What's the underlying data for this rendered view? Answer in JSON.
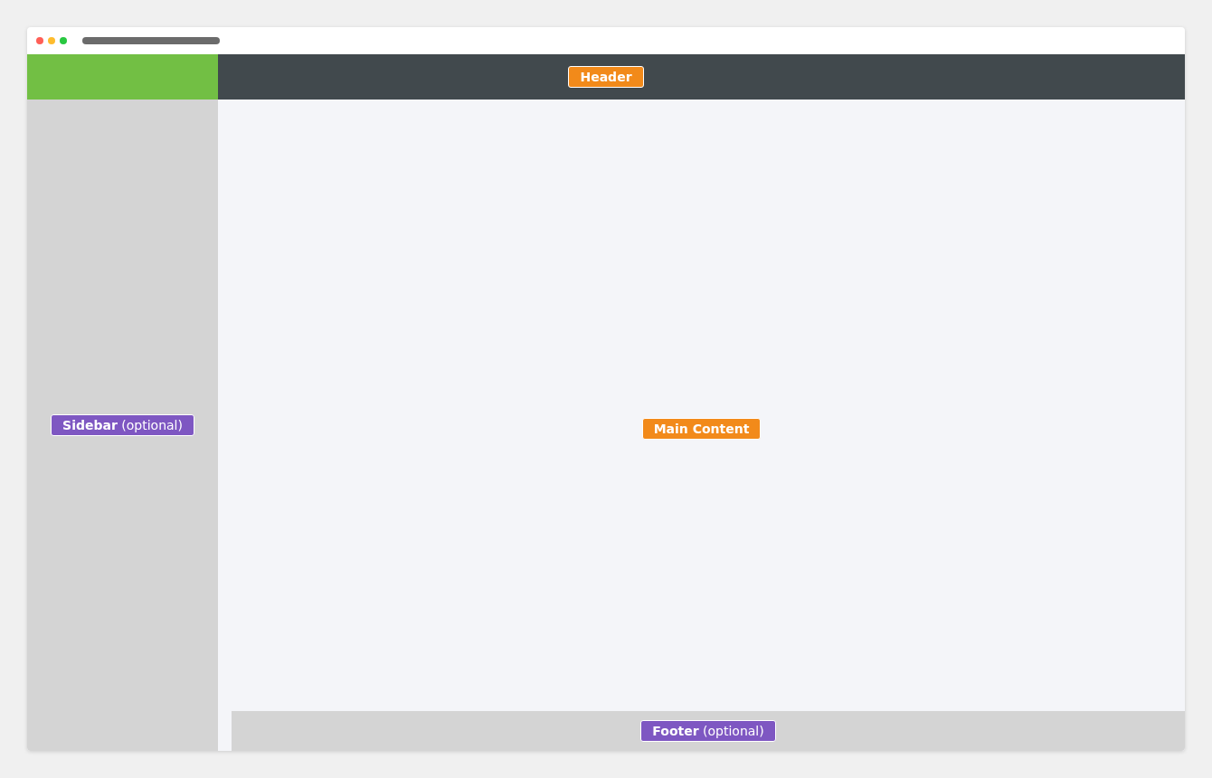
{
  "header": {
    "label": {
      "text": "Header",
      "kind": "required"
    }
  },
  "sidebar": {
    "label": {
      "text": "**Sidebar** (optional)",
      "kind": "optional"
    }
  },
  "main": {
    "label": {
      "text": "Main Content",
      "kind": "required"
    }
  },
  "footer": {
    "label": {
      "text": "**Footer** (optional)",
      "kind": "optional"
    }
  }
}
